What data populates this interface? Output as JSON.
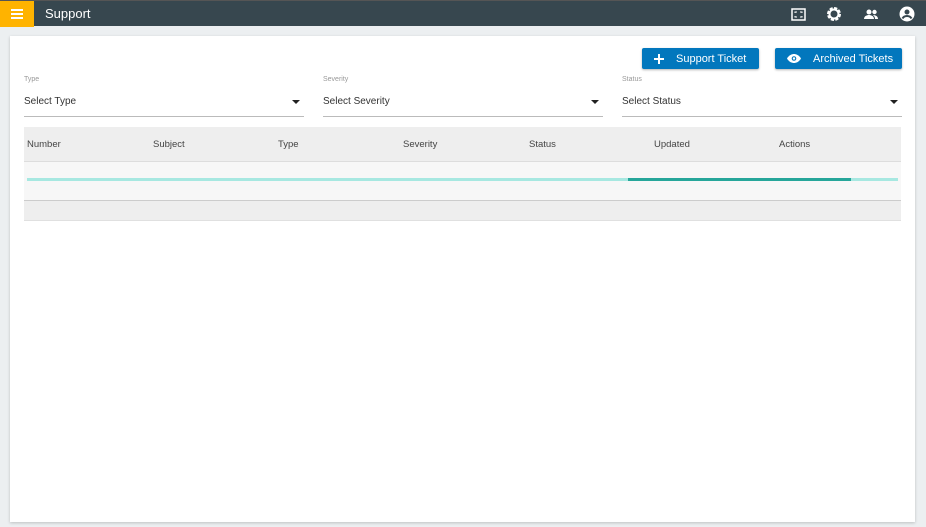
{
  "header": {
    "title": "Support",
    "icons": [
      "menu-icon",
      "fullscreen-icon",
      "settings-icon",
      "users-icon",
      "account-icon"
    ]
  },
  "actions": {
    "support_ticket": "Support Ticket",
    "archived_tickets": "Archived Tickets"
  },
  "filters": [
    {
      "label": "Type",
      "value": "Select Type"
    },
    {
      "label": "Severity",
      "value": "Select Severity"
    },
    {
      "label": "Status",
      "value": "Select Status"
    }
  ],
  "table": {
    "columns": [
      "Number",
      "Subject",
      "Type",
      "Severity",
      "Status",
      "Updated",
      "Actions"
    ]
  },
  "colors": {
    "topbar": "#37474f",
    "menu": "#ffb300",
    "button": "#0277bd",
    "progress": "#26a69a"
  }
}
